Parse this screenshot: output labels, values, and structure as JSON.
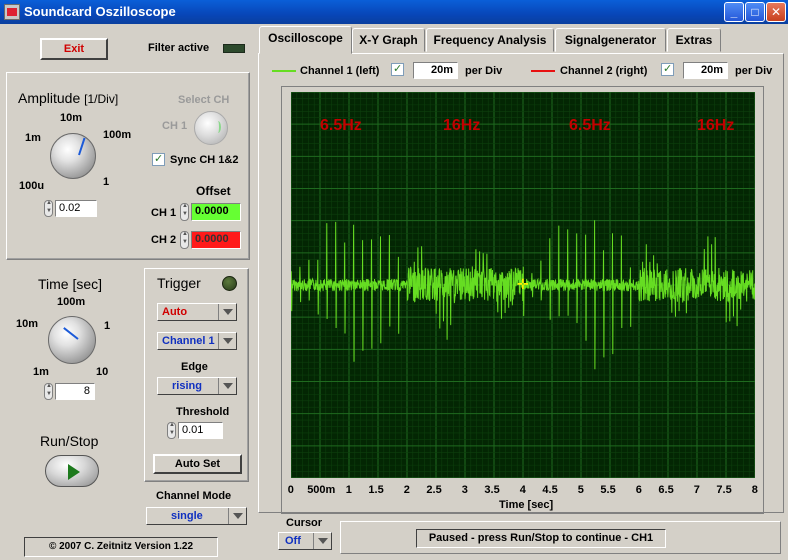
{
  "window": {
    "title": "Soundcard Oszilloscope"
  },
  "left": {
    "exit_label": "Exit",
    "filter_label": "Filter active",
    "amplitude": {
      "title": "Amplitude",
      "unit": "[1/Div]",
      "ticks": {
        "t10m": "10m",
        "t1m": "1m",
        "t100m": "100m",
        "t100u": "100u",
        "t1": "1"
      },
      "value": "0.02"
    },
    "select_ch": {
      "title": "Select CH",
      "value": "CH 1"
    },
    "sync_label": "Sync CH 1&2",
    "offset": {
      "title": "Offset",
      "ch1_label": "CH 1",
      "ch1_value": "0.0000",
      "ch2_label": "CH 2",
      "ch2_value": "0.0000"
    },
    "time": {
      "title": "Time [sec]",
      "ticks": {
        "t100m": "100m",
        "t10m": "10m",
        "t1": "1",
        "t1m": "1m",
        "t10": "10"
      },
      "value": "8"
    },
    "trigger": {
      "title": "Trigger",
      "mode": "Auto",
      "channel": "Channel 1",
      "edge_label": "Edge",
      "edge": "rising",
      "threshold_label": "Threshold",
      "threshold": "0.01",
      "autoset_label": "Auto Set"
    },
    "run_stop_label": "Run/Stop",
    "channel_mode": {
      "label": "Channel Mode",
      "value": "single"
    },
    "copyright": "© 2007  C. Zeitnitz Version 1.22"
  },
  "tabs": [
    "Oscilloscope",
    "X-Y Graph",
    "Frequency Analysis",
    "Signalgenerator",
    "Extras"
  ],
  "scope": {
    "ch1": {
      "label": "Channel 1 (left)",
      "value": "20m",
      "unit": "per Div",
      "color": "#66dd22"
    },
    "ch2": {
      "label": "Channel 2 (right)",
      "value": "20m",
      "unit": "per Div",
      "color": "#e81010"
    },
    "annotations": [
      "6.5Hz",
      "16Hz",
      "6.5Hz",
      "16Hz"
    ],
    "x_ticks": [
      "0",
      "500m",
      "1",
      "1.5",
      "2",
      "2.5",
      "3",
      "3.5",
      "4",
      "4.5",
      "5",
      "5.5",
      "6",
      "6.5",
      "7",
      "7.5",
      "8"
    ],
    "x_label": "Time [sec]",
    "cursor": {
      "label": "Cursor",
      "value": "Off"
    },
    "status": "Paused - press Run/Stop to continue - CH1"
  }
}
